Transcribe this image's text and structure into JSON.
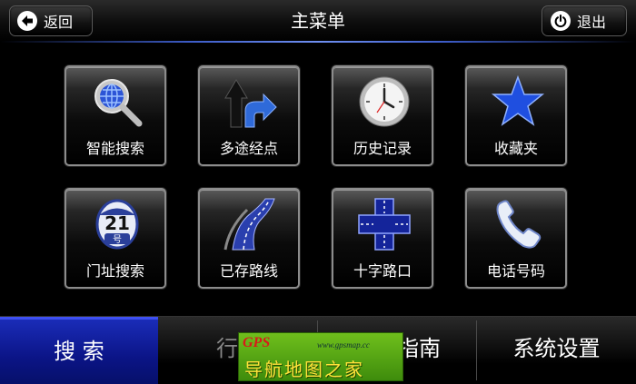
{
  "header": {
    "title": "主菜单",
    "back_label": "返回",
    "exit_label": "退出"
  },
  "grid": [
    {
      "label": "智能搜索",
      "icon": "magnifier-globe-icon"
    },
    {
      "label": "多途经点",
      "icon": "route-arrows-icon"
    },
    {
      "label": "历史记录",
      "icon": "clock-icon"
    },
    {
      "label": "收藏夹",
      "icon": "star-icon"
    },
    {
      "label": "门址搜索",
      "icon": "house-number-plate-icon"
    },
    {
      "label": "已存路线",
      "icon": "road-icon"
    },
    {
      "label": "十字路口",
      "icon": "crossroad-icon"
    },
    {
      "label": "电话号码",
      "icon": "phone-icon"
    }
  ],
  "tabs": [
    {
      "label": "搜 索",
      "active": true
    },
    {
      "label": "行程",
      "active": false
    },
    {
      "label": "旅游指南",
      "active": false
    },
    {
      "label": "系统设置",
      "active": false
    }
  ],
  "watermark": {
    "brand": "GPS",
    "url": "www.gpsmap.cc",
    "text": "导航地图之家"
  },
  "colors": {
    "accent_blue": "#0b1486",
    "header_line": "#3d5cc7",
    "tile_border": "#8c8c8c"
  }
}
